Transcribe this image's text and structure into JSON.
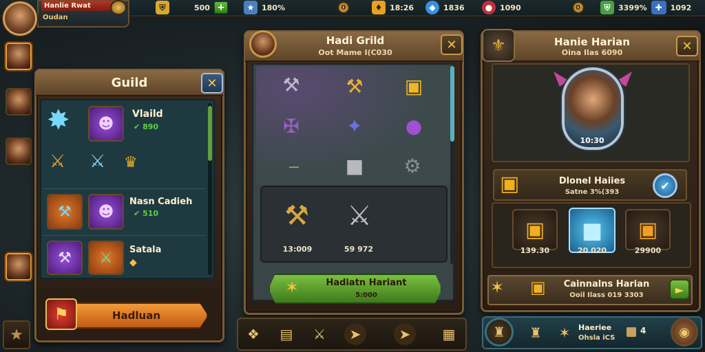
{
  "top_bar": {
    "resources": [
      {
        "icon": "gold-shield-icon",
        "value": "500",
        "color": "#d8a830"
      },
      {
        "icon": "blue-crest-icon",
        "value": "180%",
        "color": "#4a80c0"
      },
      {
        "icon": "gold-gem-icon",
        "value": "18:26",
        "color": "#e8a020"
      },
      {
        "icon": "blue-diamond-icon",
        "value": "1836",
        "color": "#3a90e0"
      },
      {
        "icon": "red-crest-icon",
        "value": "1090",
        "color": "#c03040"
      },
      {
        "icon": "green-shield-icon",
        "value": "3399%",
        "color": "#4aa040"
      },
      {
        "icon": "blue-cross-icon",
        "value": "1092",
        "color": "#3a70c0"
      }
    ]
  },
  "profile": {
    "name": "Hanlie Rwat",
    "subtitle": "Oudan"
  },
  "guild_panel": {
    "title": "Guild",
    "members": [
      {
        "name": "Vlaild",
        "score": "890"
      },
      {
        "name": "Nasn Cadieh",
        "score": "510"
      },
      {
        "name": "Satala",
        "score": ""
      }
    ],
    "action_label": "Hadluan"
  },
  "center_panel": {
    "title": "Hadi Grild",
    "subtitle": "Oot Mame I(C030",
    "featured_values": [
      "13:009",
      "59 972"
    ],
    "button_label": "Hadiatn Hariant",
    "button_sub": "5:000"
  },
  "right_panel": {
    "title": "Hanie Harian",
    "subtitle": "Oina Ilas 6090",
    "hero_value": "10:30",
    "reward_title": "Dlonel Haiies",
    "reward_sub": "Satne 3%(393",
    "reward_values": [
      "139.30",
      "20 020",
      "29900"
    ],
    "claim_title": "Cainnalns Harian",
    "claim_sub": "Ooil Ilass 019 3303"
  },
  "bottom_right": {
    "label": "Haeriee",
    "sub": "Ohsla iCS",
    "count": "4"
  },
  "colors": {
    "accent_gold": "#f4c040",
    "panel_border": "#7a5a34",
    "button_green": "#5fa040",
    "button_orange": "#e07a2a"
  }
}
